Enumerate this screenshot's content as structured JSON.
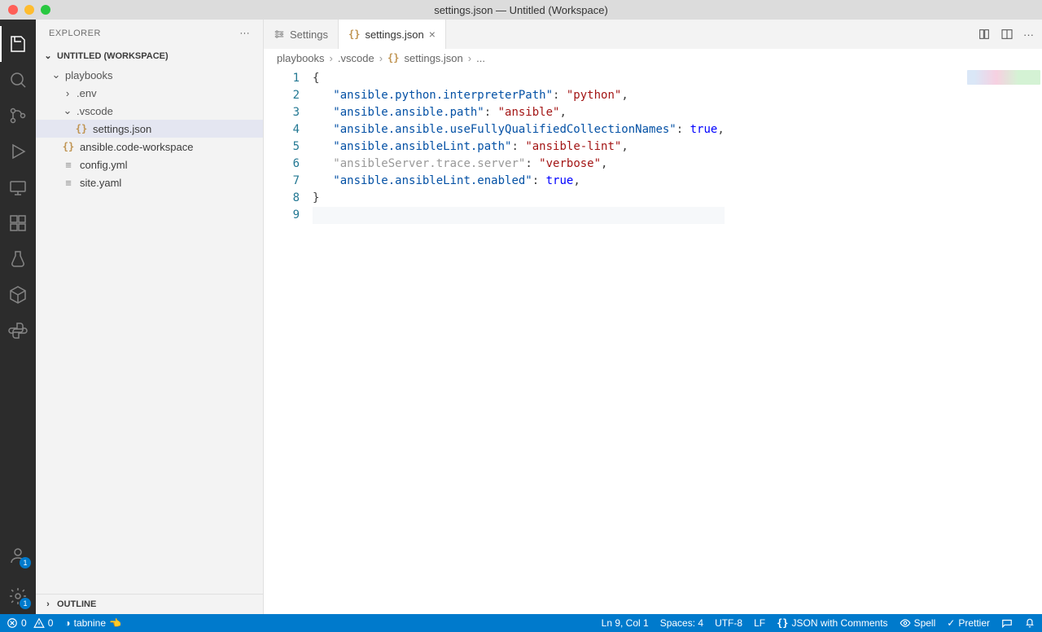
{
  "window": {
    "title": "settings.json — Untitled (Workspace)"
  },
  "explorer": {
    "title": "EXPLORER",
    "workspace": "UNTITLED (WORKSPACE)",
    "tree": {
      "root": "playbooks",
      "env": ".env",
      "vscode": ".vscode",
      "settings": "settings.json",
      "workspace_file": "ansible.code-workspace",
      "config": "config.yml",
      "site": "site.yaml"
    },
    "outline": "OUTLINE"
  },
  "tabs": {
    "settings": "Settings",
    "settings_json": "settings.json"
  },
  "breadcrumb": {
    "p0": "playbooks",
    "p1": ".vscode",
    "p2": "settings.json",
    "p3": "..."
  },
  "code": {
    "lines": [
      "1",
      "2",
      "3",
      "4",
      "5",
      "6",
      "7",
      "8",
      "9"
    ],
    "l1_brace": "{",
    "l2_key": "\"ansible.python.interpreterPath\"",
    "l2_val": "\"python\"",
    "l3_key": "\"ansible.ansible.path\"",
    "l3_val": "\"ansible\"",
    "l4_key": "\"ansible.ansible.useFullyQualifiedCollectionNames\"",
    "l4_val": "true",
    "l5_key": "\"ansible.ansibleLint.path\"",
    "l5_val": "\"ansible-lint\"",
    "l6_key": "\"ansibleServer.trace.server\"",
    "l6_val": "\"verbose\"",
    "l7_key": "\"ansible.ansibleLint.enabled\"",
    "l7_val": "true",
    "l8_brace": "}"
  },
  "status": {
    "errors": "0",
    "warnings": "0",
    "tabnine": "tabnine",
    "ln_col": "Ln 9, Col 1",
    "spaces": "Spaces: 4",
    "encoding": "UTF-8",
    "eol": "LF",
    "language": "JSON with Comments",
    "spell": "Spell",
    "prettier": "Prettier"
  },
  "accounts_badge": "1",
  "settings_badge": "1"
}
